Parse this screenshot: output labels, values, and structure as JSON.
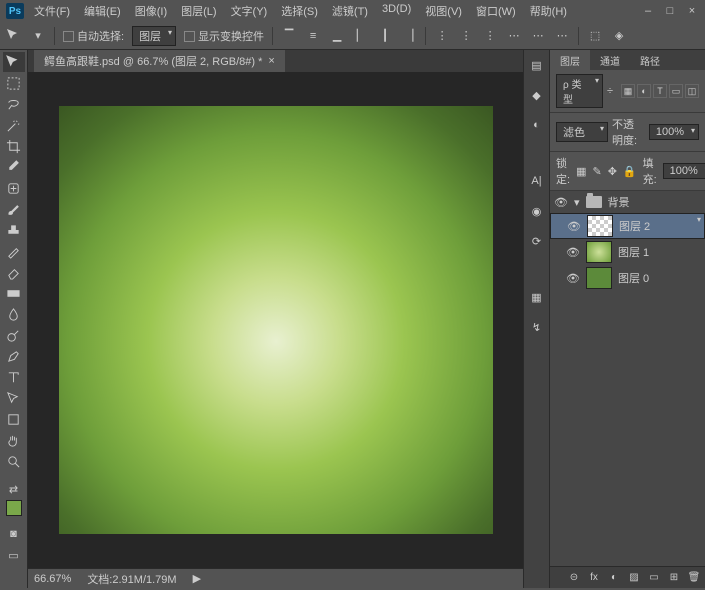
{
  "app_logo": "Ps",
  "menu": [
    "文件(F)",
    "编辑(E)",
    "图像(I)",
    "图层(L)",
    "文字(Y)",
    "选择(S)",
    "滤镜(T)",
    "3D(D)",
    "视图(V)",
    "窗口(W)",
    "帮助(H)"
  ],
  "window_buttons": {
    "min": "–",
    "max": "□",
    "close": "×"
  },
  "options_bar": {
    "auto_select_label": "自动选择:",
    "target": "图层",
    "show_transform_label": "显示变换控件"
  },
  "document": {
    "tab_title": "鳄鱼高跟鞋.psd @ 66.7% (图层 2, RGB/8#) *",
    "tab_close": "×"
  },
  "status": {
    "zoom": "66.67%",
    "docinfo": "文档:2.91M/1.79M",
    "arrow": "▶"
  },
  "layers_panel": {
    "tabs": [
      "图层",
      "通道",
      "路径"
    ],
    "kind_label": "ρ 类型",
    "kind_arrow": "÷",
    "blend_mode": "滤色",
    "opacity_label": "不透明度:",
    "opacity_value": "100%",
    "lock_label": "锁定:",
    "fill_label": "填充:",
    "fill_value": "100%",
    "group_name": "背景",
    "group_caret": "▾",
    "layers": [
      {
        "name": "图层 2",
        "thumb": "checker",
        "selected": true
      },
      {
        "name": "图层 1",
        "thumb": "green",
        "selected": false
      },
      {
        "name": "图层 0",
        "thumb": "solid",
        "selected": false
      }
    ],
    "footer_icons": [
      "⊝",
      "fx",
      "◐",
      "▨",
      "▭",
      "⊞",
      "🗑"
    ]
  },
  "tool_icons": [
    "move",
    "marquee",
    "lasso",
    "wand",
    "crop",
    "eyedrop",
    "heal",
    "brush",
    "stamp",
    "history",
    "eraser",
    "gradient",
    "blur",
    "dodge",
    "pen",
    "type",
    "path",
    "shape",
    "hand",
    "zoom"
  ],
  "color_swatches": {
    "fg": "#7aa84a",
    "bg": "#ffffff"
  },
  "right_strip_icons": [
    "swatches",
    "styles",
    "adjust",
    "char",
    "color",
    "history",
    "info",
    "brush"
  ]
}
